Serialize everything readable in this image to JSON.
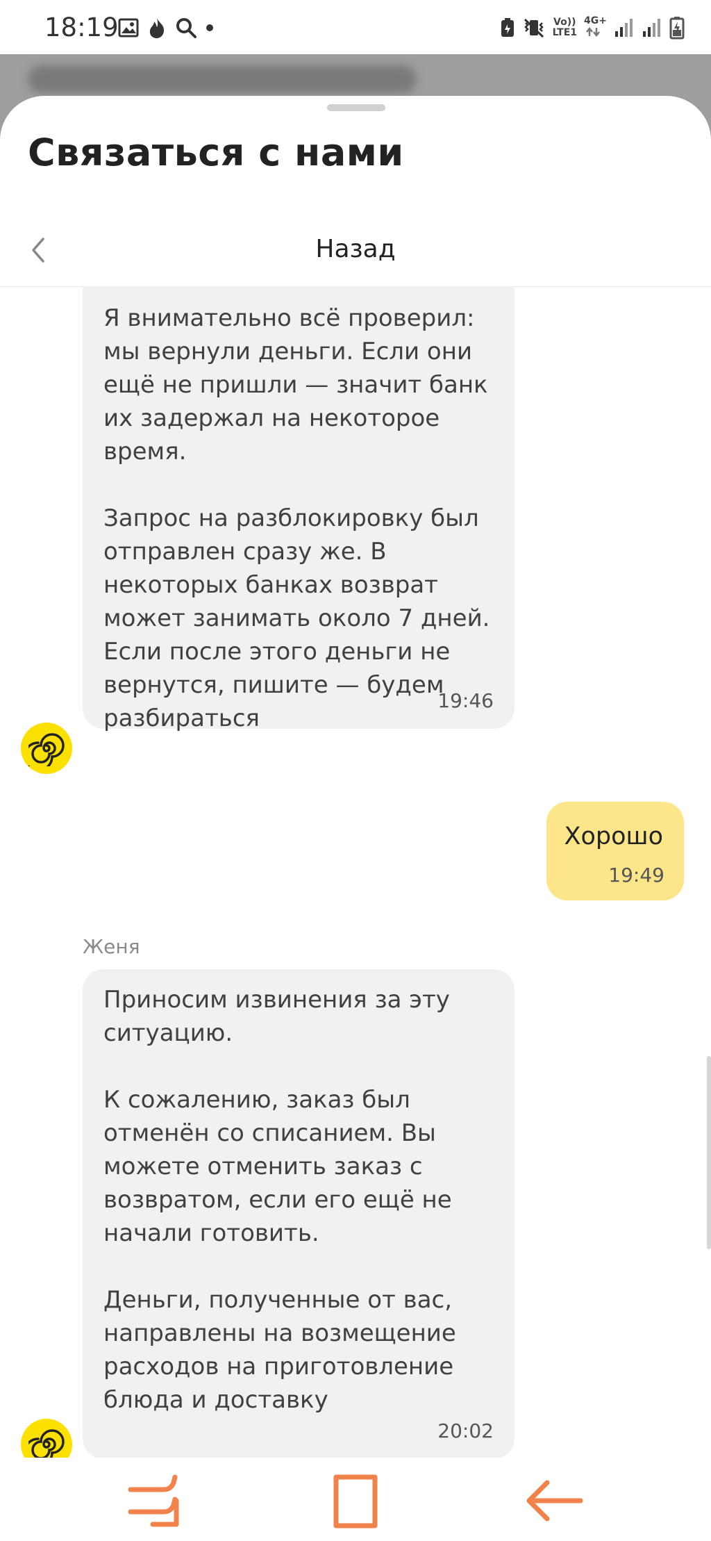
{
  "status_bar": {
    "time": "18:19",
    "left_icons": [
      "image-icon",
      "flame-icon",
      "search-icon",
      "dot-icon"
    ],
    "right_icons": [
      "battery-saver-icon",
      "vibrate-icon",
      "volte-icon",
      "4g-icon",
      "signal-1-icon",
      "signal-2-icon",
      "battery-icon"
    ],
    "volte_line1": "Vo))",
    "volte_line2": "LTE1",
    "net_type": "4G+"
  },
  "sheet": {
    "title": "Связаться с нами",
    "nav_title": "Назад"
  },
  "messages": [
    {
      "text": "Я внимательно всё проверил:\nмы вернули деньги. Если они\nещё не пришли — значит банк\nих задержал на некоторое\nвремя.\n\nЗапрос на разблокировку был\nотправлен сразу же. В\nнекоторых банках возврат\nможет занимать около 7 дней.\nЕсли после этого деньги не\nвернутся, пишите — будем\nразбираться",
      "time": "19:46"
    },
    {
      "text": "Хорошо",
      "time": "19:49"
    },
    {
      "sender": "Женя",
      "text": "Приносим извинения за эту\nситуацию.\n\nК сожалению, заказ был\nотменён со списанием. Вы\nможете отменить заказ с\nвозвратом, если его ещё не\nначали готовить.\n\nДеньги, полученные от вас,\nнаправлены на возмещение\nрасходов на приготовление\nблюда и доставку",
      "time": "20:02"
    }
  ],
  "colors": {
    "incoming_bubble": "#f2f1ef",
    "outgoing_bubble": "#fde68a",
    "avatar": "#fce000",
    "nav_accent": "#f0824a"
  },
  "bottom_nav": [
    "recents-icon",
    "home-icon",
    "back-arrow-icon"
  ]
}
